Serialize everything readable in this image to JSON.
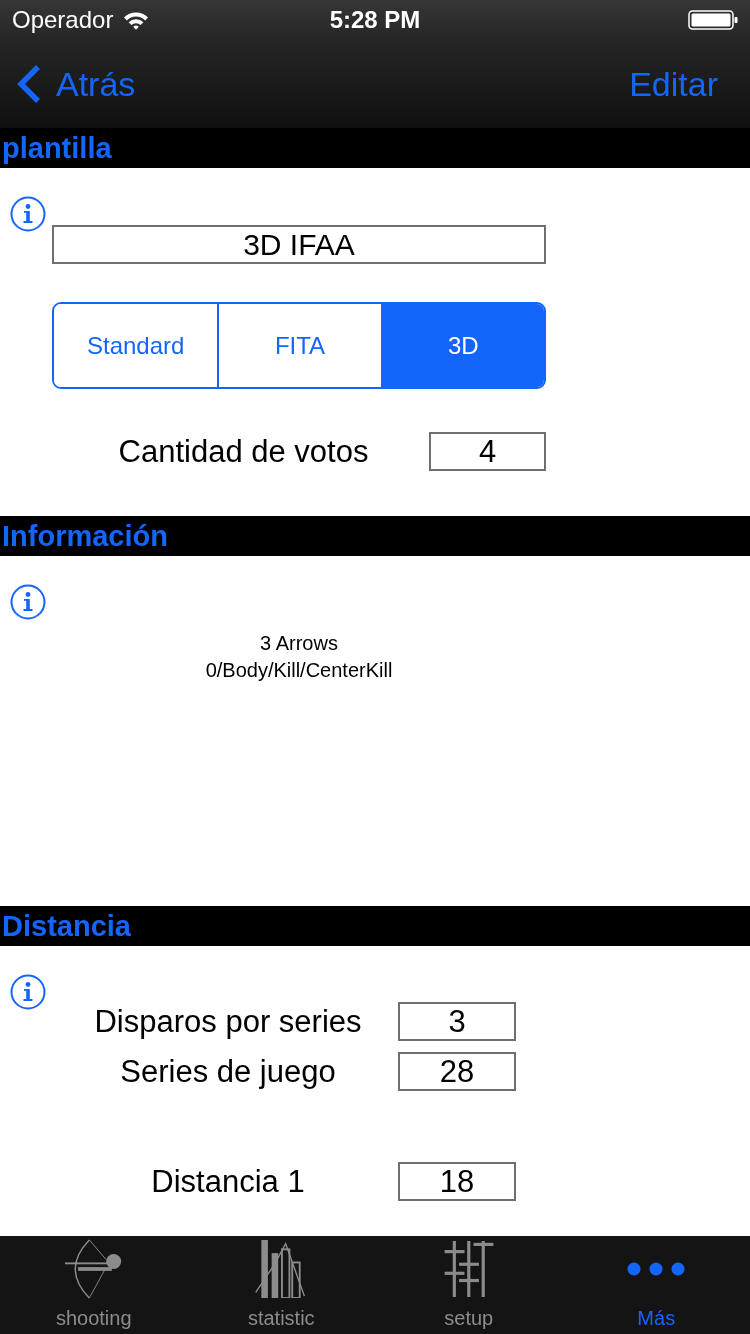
{
  "status_bar": {
    "carrier": "Operador",
    "time": "5:28 PM"
  },
  "nav_bar": {
    "back": "Atrás",
    "action": "Editar"
  },
  "sections": [
    {
      "kind": "template",
      "title": "plantilla",
      "name": "3D IFAA",
      "segments": [
        {
          "label": "Standard",
          "selected": false
        },
        {
          "label": "FITA",
          "selected": false
        },
        {
          "label": "3D",
          "selected": true
        }
      ],
      "fields": [
        {
          "label": "Cantidad de votos",
          "value": "4"
        }
      ]
    },
    {
      "kind": "info",
      "title": "Información",
      "lines": [
        "3 Arrows",
        "0/Body/Kill/CenterKill"
      ]
    },
    {
      "kind": "distance",
      "title": "Distancia",
      "groups": [
        {
          "fields": [
            {
              "label": "Disparos por series",
              "value": "3"
            },
            {
              "label": "Series de juego",
              "value": "28"
            }
          ]
        },
        {
          "fields": [
            {
              "label": "Distancia 1",
              "value": "18"
            }
          ]
        }
      ]
    }
  ],
  "tab_bar": [
    {
      "kind": "bow",
      "label": "shooting",
      "selected": false
    },
    {
      "kind": "chart",
      "label": "statistic",
      "selected": false
    },
    {
      "kind": "sliders",
      "label": "setup",
      "selected": false
    },
    {
      "kind": "more",
      "label": "Más",
      "selected": true
    }
  ]
}
